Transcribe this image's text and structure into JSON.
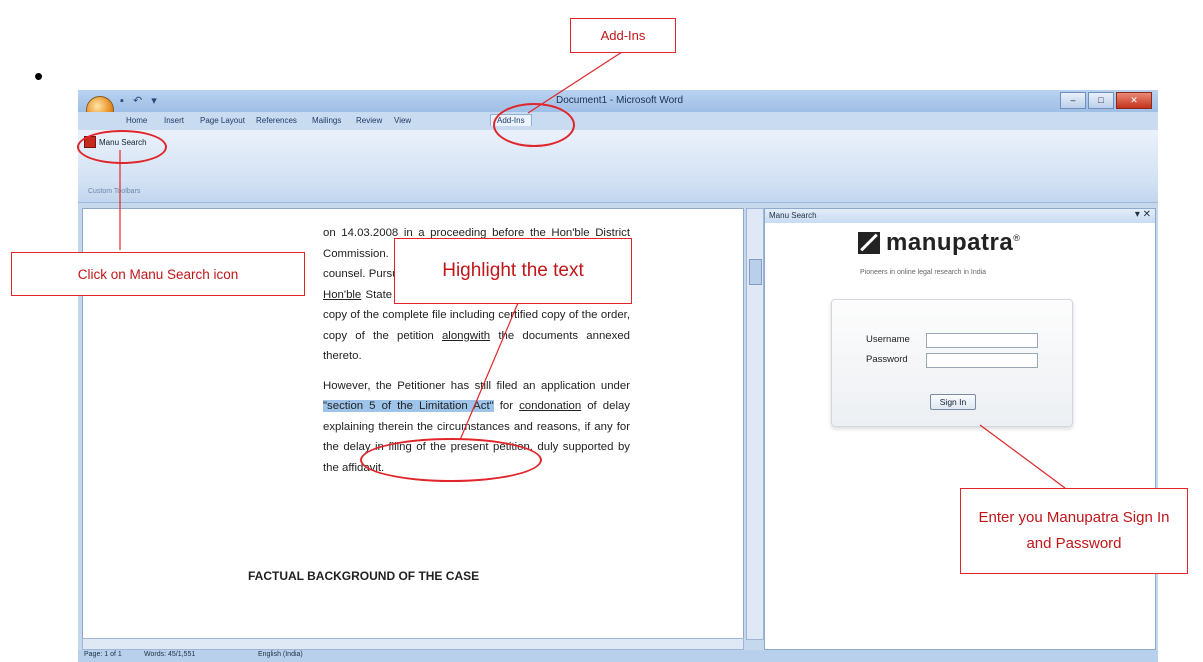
{
  "window": {
    "title": "Document1 - Microsoft Word",
    "quick_access": "▪ ↶ ▾",
    "controls": {
      "minimize": "–",
      "maximize": "□",
      "close": "✕"
    }
  },
  "ribbon": {
    "tabs": [
      "Home",
      "Insert",
      "Page Layout",
      "References",
      "Mailings",
      "Review",
      "View",
      "Add-Ins"
    ],
    "active_tab": "Add-Ins",
    "button_label": "Manu Search",
    "group_label": "Custom Toolbars"
  },
  "document": {
    "para1_a": "on 14.03.2008 in a proceeding before the Hon'ble District Commission. Institutional ... hearing copy ... Petitioner's counsel. Pursuant thereto Petitioner inspected the records at ",
    "para1_link": "Hon'ble",
    "para1_b": " State Commission and also applied for the certified copy of the complete file including certified copy of the order, copy of the petition ",
    "para1_link2": "alongwith",
    "para1_c": " the documents annexed thereto.",
    "para2_a": "However, the Petitioner has still filed an application under ",
    "para2_highlight": "\"section 5 of the Limitation Act\"",
    "para2_b": " for ",
    "para2_link": "condonation",
    "para2_c": " of delay explaining therein the circumstances and reasons, if any for the delay in filing of the present petition, duly supported by the affidavit.",
    "heading": "FACTUAL BACKGROUND OF THE CASE"
  },
  "status_bar": {
    "page": "Page: 1 of 1",
    "words": "Words: 45/1,551",
    "language": "English (India)"
  },
  "task_pane": {
    "title": "Manu Search",
    "close": "▾ ✕",
    "logo_text": "manupatra",
    "logo_reg": "®",
    "tagline": "Pioneers in online legal research in India",
    "username_label": "Username",
    "password_label": "Password",
    "signin_label": "Sign In"
  },
  "annotations": {
    "addins": "Add-Ins",
    "click_manu": "Click on Manu Search icon",
    "highlight": "Highlight the text",
    "enter_signin": "Enter you Manupatra Sign In and Password"
  },
  "colors": {
    "annotation": "#e0262a",
    "highlight": "#9fc4ea"
  }
}
